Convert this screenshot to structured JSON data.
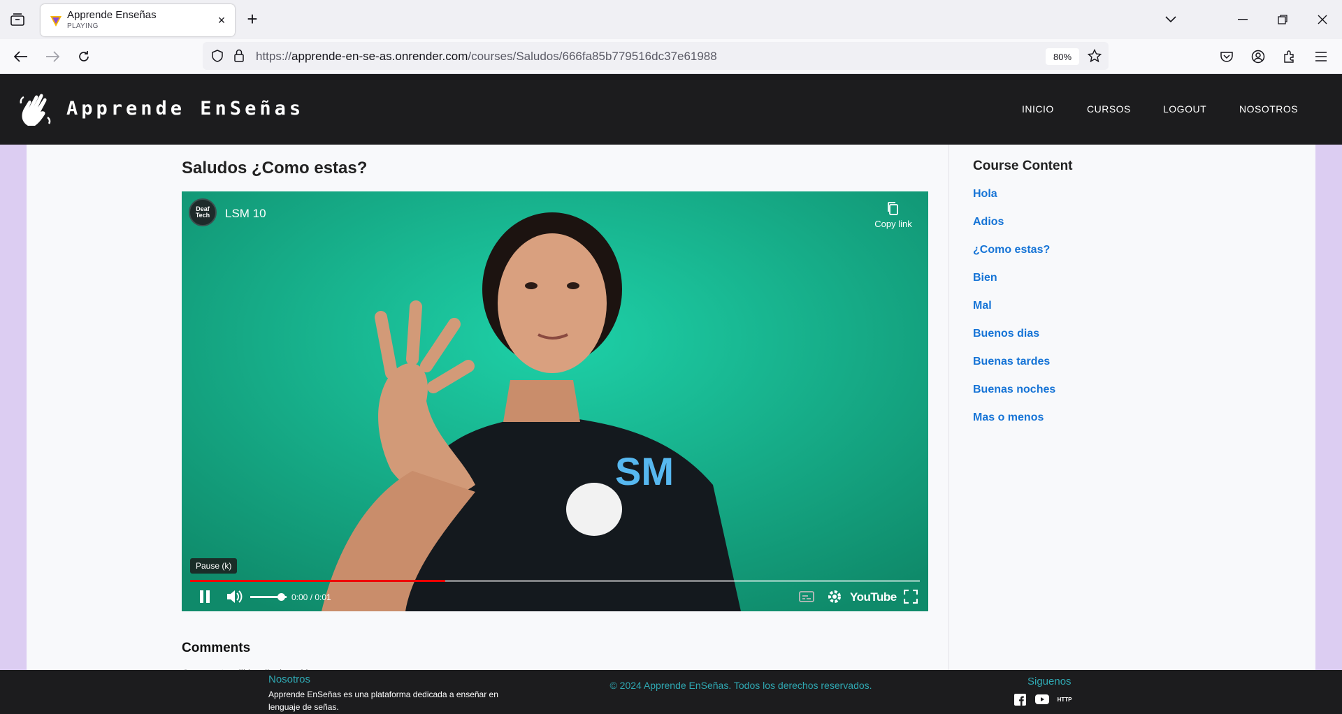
{
  "browser": {
    "tab": {
      "title": "Apprende Enseñas",
      "status": "PLAYING",
      "close": "×"
    },
    "new_tab": "+",
    "url": {
      "prefix": "https://",
      "host": "apprende-en-se-as.onrender.com",
      "path": "/courses/Saludos/666fa85b779516dc37e61988"
    },
    "zoom": "80%"
  },
  "site": {
    "brand": "Apprende EnSeñas",
    "nav": [
      "INICIO",
      "CURSOS",
      "LOGOUT",
      "NOSOTROS"
    ]
  },
  "lesson": {
    "title": "Saludos ¿Como estas?",
    "video": {
      "channel_badge": "Deaf Tech",
      "title": "LSM 10",
      "copy_link": "Copy link",
      "tooltip": "Pause (k)",
      "time": "0:00 / 0:01",
      "progress": 0.35,
      "volume": 0.85,
      "youtube_label": "YouTube",
      "shirt_text": "SM"
    },
    "comments_title": "Comments",
    "comments_empty": "Comments will be displayed here"
  },
  "course_content": {
    "title": "Course Content",
    "items": [
      "Hola",
      "Adios",
      "¿Como estas?",
      "Bien",
      "Mal",
      "Buenos dias",
      "Buenas tardes",
      "Buenas noches",
      "Mas o menos"
    ]
  },
  "footer": {
    "about_title": "Nosotros",
    "about_text": "Apprende EnSeñas es una plataforma dedicada a enseñar en lenguaje de señas.",
    "copyright": "© 2024 Apprende EnSeñas. Todos los derechos reservados.",
    "social_title": "Siguenos",
    "social_http": "HTTP"
  },
  "colors": {
    "header_bg": "#1c1c1e",
    "page_side": "#dccdf2",
    "link": "#1674d6",
    "footer_accent": "#2fa8b2",
    "video_green": "#1a9c7d",
    "progress_red": "#e00"
  }
}
